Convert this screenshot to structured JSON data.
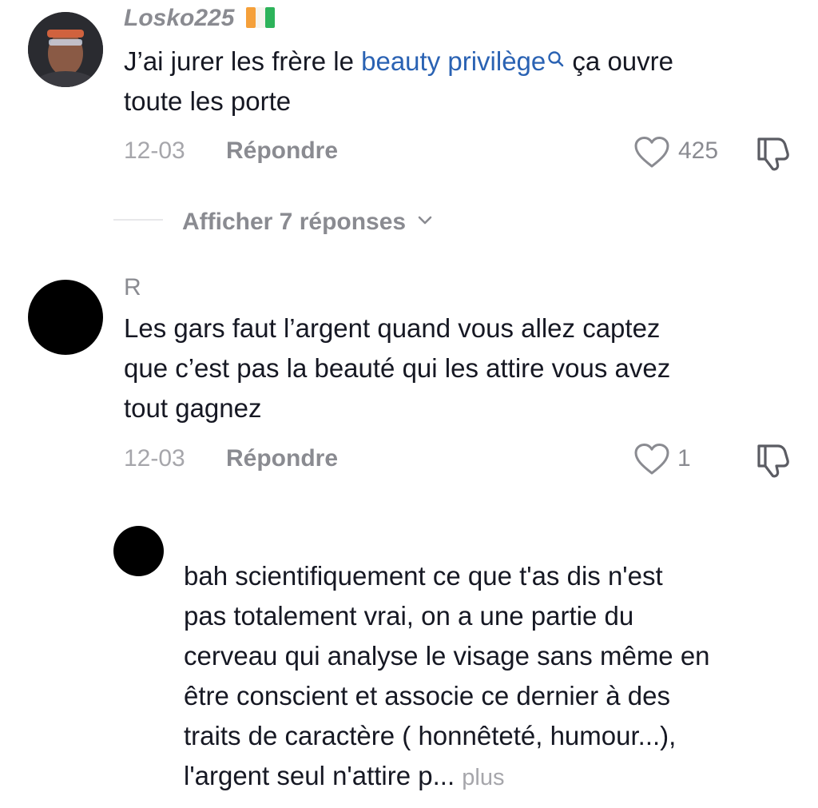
{
  "comments": [
    {
      "username": "Losko225",
      "flag": "🇨🇮",
      "text_before": "J’ai jurer les frère le ",
      "link_text": "beauty privilège",
      "text_after_line1": " ça ouvre",
      "text_line2": "toute les porte",
      "date": "12-03",
      "reply_label": "Répondre",
      "like_count": "425"
    },
    {
      "username": "R",
      "text_lines": [
        "Les gars faut l’argent quand vous allez captez",
        "que c’est pas la beauté qui les attire vous avez",
        "tout gagnez"
      ],
      "date": "12-03",
      "reply_label": "Répondre",
      "like_count": "1"
    }
  ],
  "view_replies": {
    "label": "Afficher 7 réponses"
  },
  "reply": {
    "text_lines": [
      "bah scientifiquement ce que t'as dis n'est",
      "pas totalement vrai, on a une partie du",
      "cerveau qui analyse le visage sans même en",
      "être conscient et associe ce dernier à des",
      "traits de caractère ( honnêteté, humour...),",
      "l'argent seul n'attire p..."
    ],
    "more_label": "plus"
  },
  "icons": {
    "heart": "heart-outline-icon",
    "dislike": "thumbs-down-outline-icon",
    "search": "search-icon",
    "chevron": "chevron-down-icon"
  }
}
